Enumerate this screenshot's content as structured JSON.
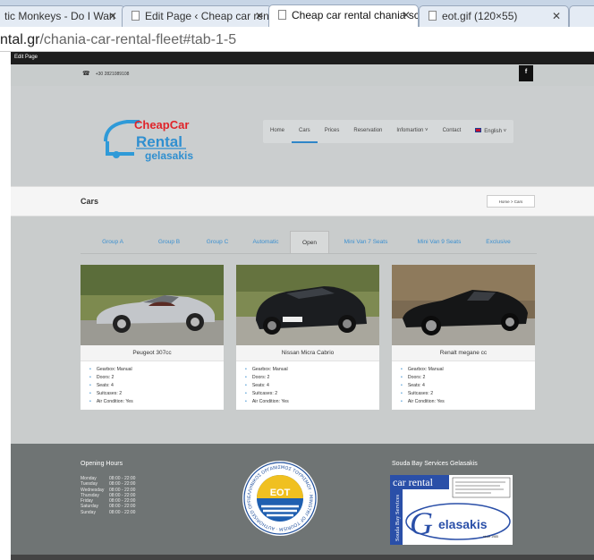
{
  "browser": {
    "tabs": [
      {
        "title": "tic Monkeys - Do I Wan",
        "active": false
      },
      {
        "title": "Edit Page ‹ Cheap car rent",
        "active": false
      },
      {
        "title": "Cheap car rental chania sc",
        "active": true
      },
      {
        "title": "eot.gif (120×55)",
        "active": false
      }
    ],
    "url_host": "ntal.gr",
    "url_path": "/chania-car-rental-fleet#tab-1-5"
  },
  "admin_bar": {
    "edit_page": "Edit Page"
  },
  "topbar": {
    "phone": "+30 2821089108",
    "facebook": "f"
  },
  "logo": {
    "line1": "CheapCar",
    "line2": "Rental",
    "line3": "gelasakis"
  },
  "nav": {
    "items": [
      "Home",
      "Cars",
      "Prices",
      "Reservation",
      "Infomartion ˅",
      "Contact",
      "English ˅"
    ],
    "active_index": 1
  },
  "page": {
    "title": "Cars",
    "breadcrumb": "Home > Cars"
  },
  "fleet_tabs": {
    "items": [
      "Group A",
      "Group B",
      "Group C",
      "Automatic",
      "Open",
      "Mini Van 7 Seats",
      "Mini Van 9 Seats",
      "Exclusive"
    ],
    "active_index": 4
  },
  "cars": [
    {
      "name": "Peugeot 307cc",
      "color": "#b9bcc0",
      "specs": [
        "Gearbox: Manual",
        "Doors: 2",
        "Seats: 4",
        "Suitcases: 2",
        "Air Condition: Yes"
      ]
    },
    {
      "name": "Nissan Micra Cabrio",
      "color": "#1b1d20",
      "specs": [
        "Gearbox: Manual",
        "Doors: 2",
        "Seats: 4",
        "Suitcases: 2",
        "Air Condition: Yes"
      ]
    },
    {
      "name": "Renalt megane cc",
      "color": "#151617",
      "specs": [
        "Gearbox: Manual",
        "Doors: 2",
        "Seats: 4",
        "Suitcases: 2",
        "Air Condition: Yes"
      ]
    }
  ],
  "footer": {
    "hours_title": "Opening Hours",
    "hours": [
      {
        "day": "Monday",
        "time": "08:00 - 22:00"
      },
      {
        "day": "Tuesday",
        "time": "08:00 - 22:00"
      },
      {
        "day": "Wednesday",
        "time": "08:00 - 22:00"
      },
      {
        "day": "Thursday",
        "time": "08:00 - 22:00"
      },
      {
        "day": "Friday",
        "time": "08:00 - 22:00"
      },
      {
        "day": "Saturday",
        "time": "08:00 - 22:00"
      },
      {
        "day": "Sunday",
        "time": "08:00 - 22:00"
      }
    ],
    "eot": {
      "center": "EOT",
      "ring": "ΕΛΛΗΝΙΚΟΣ ΟΡΓΑΝΙΣΜΟΣ ΤΟΥΡΙΣΜΟΥ · MINISTRY OF TOURISM · AUTHORISED OFFICE ·"
    },
    "services_title": "Souda Bay Services Gelasakis",
    "services_logo": {
      "top": "car rental",
      "side": "Souda Bay Services",
      "brand": "elasakis",
      "since": "since 1985"
    }
  },
  "colors": {
    "accent": "#2f86c8",
    "page_bg": "#c9cccc",
    "footer_bg": "#6f7474"
  }
}
